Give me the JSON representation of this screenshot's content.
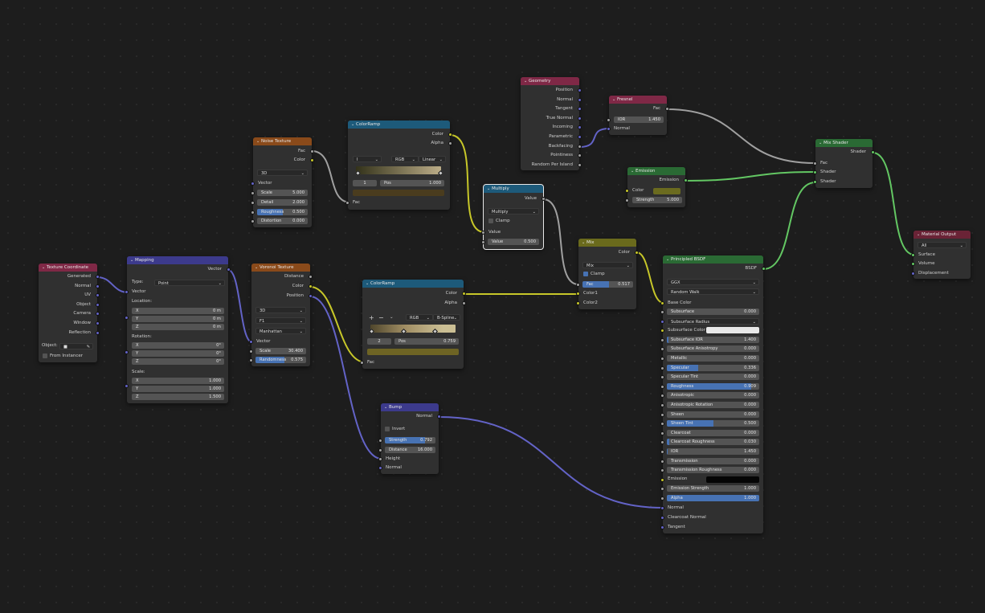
{
  "nodes": {
    "noise": {
      "title": "Noise Texture",
      "out_fac": "Fac",
      "out_color": "Color",
      "dim": "3D",
      "in_vector": "Vector",
      "scale_label": "Scale",
      "scale": "5.000",
      "detail_label": "Detail",
      "detail": "2.000",
      "rough_label": "Roughness",
      "rough": "0.500",
      "rough_fill": 0.5,
      "dist_label": "Distortion",
      "dist": "0.000"
    },
    "ramp1": {
      "title": "ColorRamp",
      "out_color": "Color",
      "out_alpha": "Alpha",
      "mode": "RGB",
      "interp": "Linear",
      "index": "1",
      "pos_label": "Pos",
      "pos": "1.000",
      "in_fac": "Fac"
    },
    "geometry": {
      "title": "Geometry",
      "outputs": [
        "Position",
        "Normal",
        "Tangent",
        "True Normal",
        "Incoming",
        "Parametric",
        "Backfacing",
        "Pointiness",
        "Random Per Island"
      ]
    },
    "fresnel": {
      "title": "Fresnel",
      "out_fac": "Fac",
      "ior_label": "IOR",
      "ior": "1.450",
      "in_normal": "Normal"
    },
    "multiply": {
      "title": "Multiply",
      "out_value": "Value",
      "op": "Multiply",
      "clamp": "Clamp",
      "in_value": "Value",
      "val_label": "Value",
      "val": "0.500"
    },
    "emission": {
      "title": "Emission",
      "out": "Emission",
      "color_label": "Color",
      "color": "#6b6b1f",
      "strength_label": "Strength",
      "strength": "5.000"
    },
    "mixshader": {
      "title": "Mix Shader",
      "out": "Shader",
      "in_fac": "Fac",
      "in_sh1": "Shader",
      "in_sh2": "Shader"
    },
    "matout": {
      "title": "Material Output",
      "target": "All",
      "in_surface": "Surface",
      "in_volume": "Volume",
      "in_disp": "Displacement"
    },
    "texcoord": {
      "title": "Texture Coordinate",
      "outputs": [
        "Generated",
        "Normal",
        "UV",
        "Object",
        "Camera",
        "Window",
        "Reflection"
      ],
      "object_label": "Object:",
      "from_instancer": "From Instancer"
    },
    "mapping": {
      "title": "Mapping",
      "out_vector": "Vector",
      "type_label": "Type:",
      "type": "Point",
      "in_vector": "Vector",
      "loc_label": "Location:",
      "loc": [
        {
          "a": "X",
          "v": "0 m"
        },
        {
          "a": "Y",
          "v": "0 m"
        },
        {
          "a": "Z",
          "v": "0 m"
        }
      ],
      "rot_label": "Rotation:",
      "rot": [
        {
          "a": "X",
          "v": "0°"
        },
        {
          "a": "Y",
          "v": "0°"
        },
        {
          "a": "Z",
          "v": "0°"
        }
      ],
      "scale_label": "Scale:",
      "scale": [
        {
          "a": "X",
          "v": "1.000"
        },
        {
          "a": "Y",
          "v": "1.000"
        },
        {
          "a": "Z",
          "v": "1.500"
        }
      ]
    },
    "voronoi": {
      "title": "Voronoi Texture",
      "out_dist": "Distance",
      "out_color": "Color",
      "out_pos": "Position",
      "dim": "3D",
      "feature": "F1",
      "metric": "Manhattan",
      "in_vector": "Vector",
      "scale_label": "Scale",
      "scale": "30.400",
      "rand_label": "Randomness",
      "rand": "0.575",
      "rand_fill": 0.575
    },
    "ramp2": {
      "title": "ColorRamp",
      "out_color": "Color",
      "out_alpha": "Alpha",
      "mode": "RGB",
      "interp": "B-Spline",
      "plus": "+",
      "minus": "−",
      "index": "2",
      "pos_label": "Pos",
      "pos": "0.759",
      "in_fac": "Fac"
    },
    "mix": {
      "title": "Mix",
      "out_color": "Color",
      "blend": "Mix",
      "clamp": "Clamp",
      "fac_label": "Fac",
      "fac": "0.517",
      "fac_fill": 0.517,
      "in_c1": "Color1",
      "in_c2": "Color2"
    },
    "bump": {
      "title": "Bump",
      "out_normal": "Normal",
      "invert": "Invert",
      "str_label": "Strength",
      "str": "0.792",
      "str_fill": 0.792,
      "dist_label": "Distance",
      "dist": "16.000",
      "in_height": "Height",
      "in_normal": "Normal"
    },
    "bsdf": {
      "title": "Principled BSDF",
      "out": "BSDF",
      "dist": "GGX",
      "sss_method": "Random Walk",
      "base_color": "Base Color",
      "rows": [
        {
          "l": "Subsurface",
          "v": "0.000",
          "f": 0
        },
        {
          "l": "Subsurface Radius",
          "v": "",
          "f": 0
        },
        {
          "l": "Subsurface Color",
          "v": "",
          "f": 0
        },
        {
          "l": "Subsurface IOR",
          "v": "1.400",
          "f": 0.02
        },
        {
          "l": "Subsurface Anisotropy",
          "v": "0.000",
          "f": 0
        },
        {
          "l": "Metallic",
          "v": "0.000",
          "f": 0
        },
        {
          "l": "Specular",
          "v": "0.336",
          "f": 0.336
        },
        {
          "l": "Specular Tint",
          "v": "0.000",
          "f": 0
        },
        {
          "l": "Roughness",
          "v": "0.909",
          "f": 0.909
        },
        {
          "l": "Anisotropic",
          "v": "0.000",
          "f": 0
        },
        {
          "l": "Anisotropic Rotation",
          "v": "0.000",
          "f": 0
        },
        {
          "l": "Sheen",
          "v": "0.000",
          "f": 0
        },
        {
          "l": "Sheen Tint",
          "v": "0.500",
          "f": 0.5
        },
        {
          "l": "Clearcoat",
          "v": "0.000",
          "f": 0
        },
        {
          "l": "Clearcoat Roughness",
          "v": "0.030",
          "f": 0.03
        },
        {
          "l": "IOR",
          "v": "1.450",
          "f": 0.01
        },
        {
          "l": "Transmission",
          "v": "0.000",
          "f": 0
        },
        {
          "l": "Transmission Roughness",
          "v": "0.000",
          "f": 0
        },
        {
          "l": "Emission",
          "v": "",
          "f": 0
        },
        {
          "l": "Emission Strength",
          "v": "1.000",
          "f": 0
        },
        {
          "l": "Alpha",
          "v": "1.000",
          "f": 1
        }
      ],
      "in_normal": "Normal",
      "in_cc_normal": "Clearcoat Normal",
      "in_tangent": "Tangent"
    }
  },
  "colors": {
    "wire_gray": "#a0a0a0",
    "wire_yellow": "#c7c729",
    "wire_purple": "#6363c7",
    "wire_green": "#63c763",
    "accent": "#4772b3"
  }
}
